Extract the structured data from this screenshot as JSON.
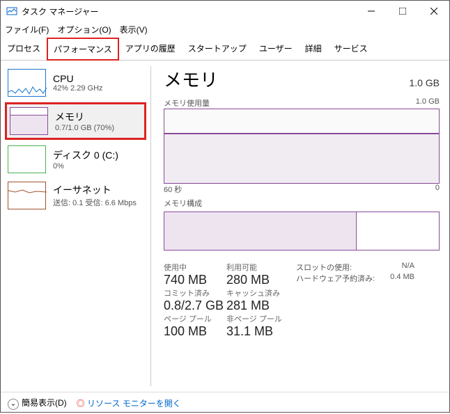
{
  "window": {
    "title": "タスク マネージャー"
  },
  "menu": {
    "file": "ファイル(F)",
    "options": "オプション(O)",
    "view": "表示(V)"
  },
  "tabs": [
    "プロセス",
    "パフォーマンス",
    "アプリの履歴",
    "スタートアップ",
    "ユーザー",
    "詳細",
    "サービス"
  ],
  "sidebar": {
    "cpu": {
      "name": "CPU",
      "sub": "42%  2.29 GHz"
    },
    "memory": {
      "name": "メモリ",
      "sub": "0.7/1.0 GB (70%)"
    },
    "disk": {
      "name": "ディスク 0 (C:)",
      "sub": "0%"
    },
    "net": {
      "name": "イーサネット",
      "sub": "送信: 0.1 受信: 6.6 Mbps"
    }
  },
  "details": {
    "title": "メモリ",
    "total": "1.0 GB",
    "usage_label": "メモリ使用量",
    "usage_max": "1.0 GB",
    "x_left": "60 秒",
    "x_right": "0",
    "comp_label": "メモリ構成"
  },
  "stats": {
    "in_use": {
      "label": "使用中",
      "val": "740 MB"
    },
    "avail": {
      "label": "利用可能",
      "val": "280 MB"
    },
    "commit": {
      "label": "コミット済み",
      "val": "0.8/2.7 GB"
    },
    "cached": {
      "label": "キャッシュ済み",
      "val": "281 MB"
    },
    "paged": {
      "label": "ページ プール",
      "val": "100 MB"
    },
    "nonpaged": {
      "label": "非ページ プール",
      "val": "31.1 MB"
    },
    "slot": {
      "label": "スロットの使用:",
      "val": "N/A"
    },
    "hw": {
      "label": "ハードウェア予約済み:",
      "val": "0.4 MB"
    }
  },
  "bottom": {
    "fewer": "簡易表示(D)",
    "resmon": "リソース モニターを開く"
  },
  "chart_data": {
    "type": "line",
    "title": "メモリ使用量",
    "ylabel": "GB",
    "ylim": [
      0,
      1.0
    ],
    "x_range_seconds": [
      60,
      0
    ],
    "series": [
      {
        "name": "メモリ使用量",
        "approx_value_gb": 0.7
      }
    ],
    "composition_used_fraction": 0.7
  }
}
